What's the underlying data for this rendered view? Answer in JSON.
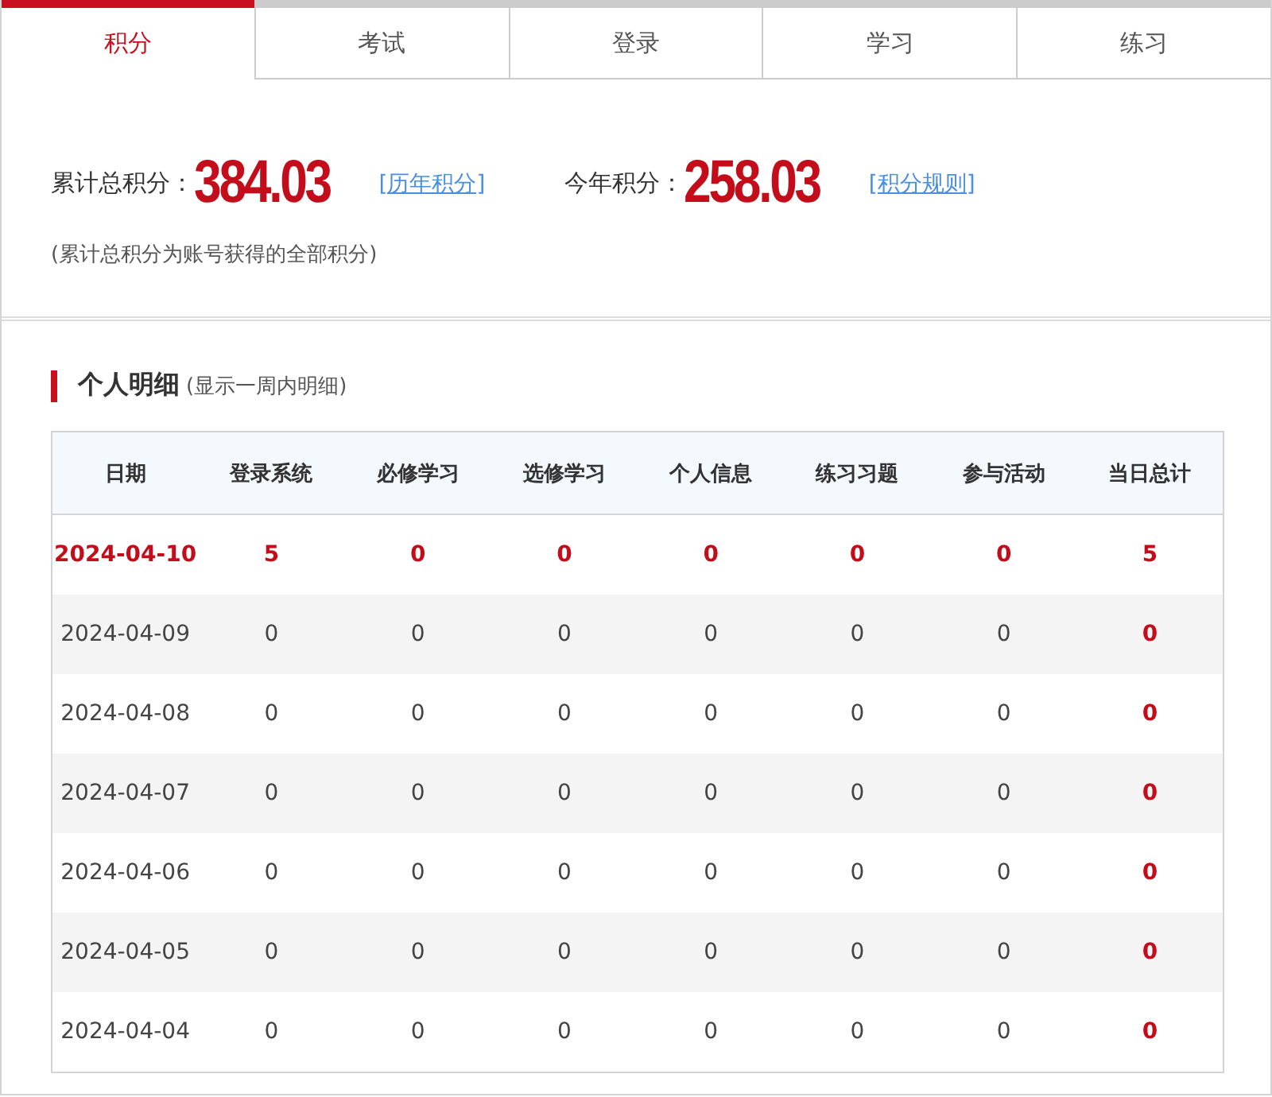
{
  "tabs": [
    {
      "label": "积分",
      "selected": true
    },
    {
      "label": "考试",
      "selected": false
    },
    {
      "label": "登录",
      "selected": false
    },
    {
      "label": "学习",
      "selected": false
    },
    {
      "label": "练习",
      "selected": false
    }
  ],
  "summary": {
    "total_label": "累计总积分：",
    "total_value": "384.03",
    "total_link": "[历年积分]",
    "year_label": "今年积分：",
    "year_value": "258.03",
    "year_link": "[积分规则]",
    "note": "(累计总积分为账号获得的全部积分)"
  },
  "detail": {
    "title": "个人明细",
    "subtitle": "(显示一周内明细)",
    "columns": [
      "日期",
      "登录系统",
      "必修学习",
      "选修学习",
      "个人信息",
      "练习习题",
      "参与活动",
      "当日总计"
    ],
    "rows": [
      {
        "highlighted": true,
        "cells": [
          "2024-04-10",
          "5",
          "0",
          "0",
          "0",
          "0",
          "0",
          "5"
        ]
      },
      {
        "highlighted": false,
        "cells": [
          "2024-04-09",
          "0",
          "0",
          "0",
          "0",
          "0",
          "0",
          "0"
        ]
      },
      {
        "highlighted": false,
        "cells": [
          "2024-04-08",
          "0",
          "0",
          "0",
          "0",
          "0",
          "0",
          "0"
        ]
      },
      {
        "highlighted": false,
        "cells": [
          "2024-04-07",
          "0",
          "0",
          "0",
          "0",
          "0",
          "0",
          "0"
        ]
      },
      {
        "highlighted": false,
        "cells": [
          "2024-04-06",
          "0",
          "0",
          "0",
          "0",
          "0",
          "0",
          "0"
        ]
      },
      {
        "highlighted": false,
        "cells": [
          "2024-04-05",
          "0",
          "0",
          "0",
          "0",
          "0",
          "0",
          "0"
        ]
      },
      {
        "highlighted": false,
        "cells": [
          "2024-04-04",
          "0",
          "0",
          "0",
          "0",
          "0",
          "0",
          "0"
        ]
      }
    ]
  }
}
